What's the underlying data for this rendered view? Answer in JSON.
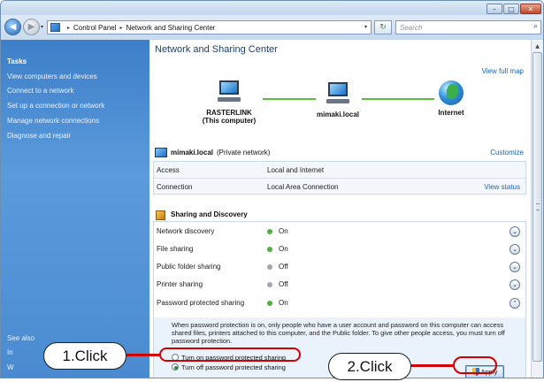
{
  "window": {
    "buttons": {
      "minimize": "–",
      "maximize": "□",
      "close": "✕"
    }
  },
  "address_bar": {
    "back_glyph": "◀",
    "forward_glyph": "▶",
    "crumbs": [
      "Control Panel",
      "Network and Sharing Center"
    ],
    "separator": "▸",
    "dropdown_glyph": "▾",
    "refresh_glyph": "↻",
    "search_placeholder": "Search",
    "search_glyph": "⌕"
  },
  "sidebar": {
    "heading": "Tasks",
    "items": [
      "View computers and devices",
      "Connect to a network",
      "Set up a connection or network",
      "Manage network connections",
      "Diagnose and repair"
    ],
    "see_also_heading": "See also",
    "see_also_items": [
      "In",
      "W"
    ]
  },
  "main": {
    "title": "Network and Sharing Center",
    "view_full_map": "View full map",
    "map": {
      "computer_name": "RASTERLINK",
      "computer_note": "(This computer)",
      "middle_node": "mimaki.local",
      "internet": "Internet"
    },
    "network": {
      "name": "mimaki.local",
      "type": "(Private network)",
      "customize": "Customize",
      "rows": [
        {
          "label": "Access",
          "value": "Local and Internet",
          "link": ""
        },
        {
          "label": "Connection",
          "value": "Local Area Connection",
          "link": "View status"
        }
      ]
    },
    "sharing": {
      "heading": "Sharing and Discovery",
      "rows": [
        {
          "label": "Network discovery",
          "value": "On",
          "status_color": "#4cb33a",
          "expand": "⌄"
        },
        {
          "label": "File sharing",
          "value": "On",
          "status_color": "#4cb33a",
          "expand": "⌄"
        },
        {
          "label": "Public folder sharing",
          "value": "Off",
          "status_color": "#9ea6b0",
          "expand": "⌄"
        },
        {
          "label": "Printer sharing",
          "value": "Off",
          "status_color": "#9ea6b0",
          "expand": "⌄"
        },
        {
          "label": "Password protected sharing",
          "value": "On",
          "status_color": "#4cb33a",
          "expand": "⌃"
        }
      ],
      "detail_text": "When password protection is on, only people who have a user account and password on this computer can access shared files, printers attached to this computer, and the Public folder. To give other people access, you must turn off password protection.",
      "option_on": "Turn on password protected sharing",
      "option_off": "Turn off password protected sharing",
      "apply_label": "Apply"
    }
  },
  "scrollbar": {
    "up_glyph": "▲"
  },
  "annotations": {
    "step1": "1.Click",
    "step2": "2.Click",
    "highlight_color": "#d10000"
  }
}
